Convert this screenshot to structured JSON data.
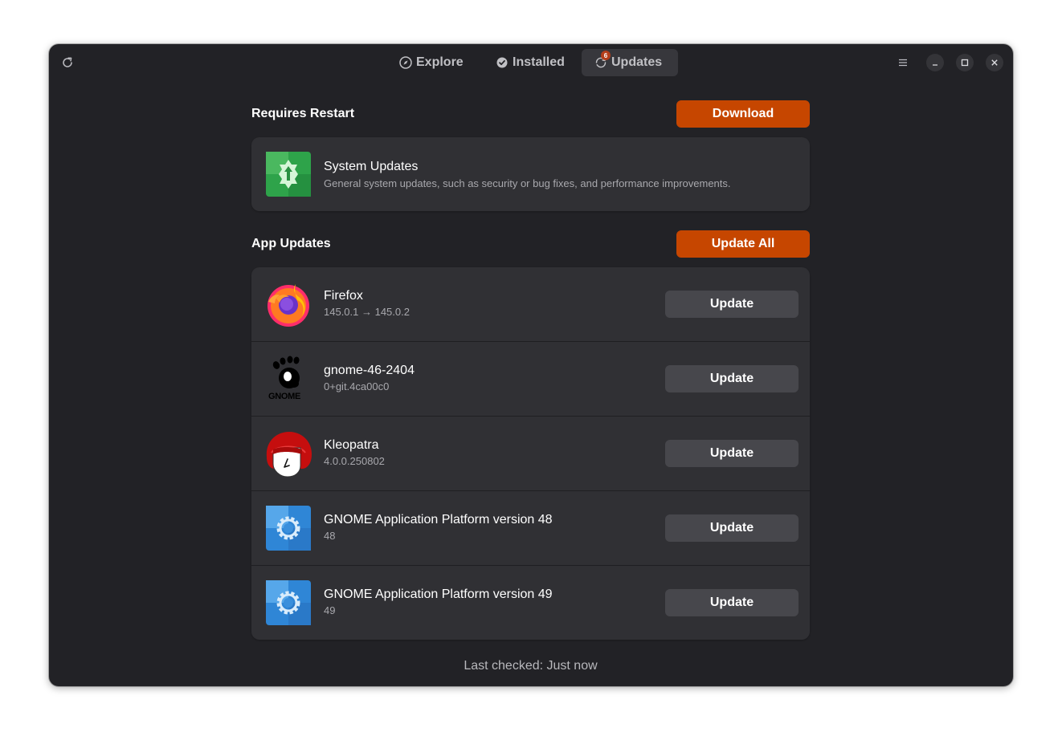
{
  "tabs": [
    {
      "label": "Explore",
      "icon": "compass-icon",
      "active": false
    },
    {
      "label": "Installed",
      "icon": "check-circle-icon",
      "active": false
    },
    {
      "label": "Updates",
      "icon": "sync-icon",
      "active": true,
      "badge": "6"
    }
  ],
  "restart_section": {
    "title": "Requires Restart",
    "button_label": "Download",
    "item": {
      "name": "System Updates",
      "description": "General system updates, such as security or bug fixes, and performance improvements.",
      "icon": "system-updates-icon"
    }
  },
  "app_section": {
    "title": "App Updates",
    "button_label": "Update All",
    "items": [
      {
        "name": "Firefox",
        "version": "145.0.1 → 145.0.2",
        "button_label": "Update",
        "icon": "firefox-icon"
      },
      {
        "name": "gnome-46-2404",
        "version": "0+git.4ca00c0",
        "button_label": "Update",
        "icon": "gnome-foot-icon",
        "logo_text": "GNOME"
      },
      {
        "name": "Kleopatra",
        "version": "4.0.0.250802",
        "button_label": "Update",
        "icon": "kleopatra-icon"
      },
      {
        "name": "GNOME Application Platform version 48",
        "version": "48",
        "button_label": "Update",
        "icon": "gnome-platform-icon"
      },
      {
        "name": "GNOME Application Platform version 49",
        "version": "49",
        "button_label": "Update",
        "icon": "gnome-platform-icon"
      }
    ]
  },
  "footer": {
    "text": "Last checked: Just now"
  },
  "colors": {
    "accent": "#c64600",
    "window_bg": "#222226",
    "card_bg": "#303034",
    "button_bg": "#47474c",
    "badge": "#b43e1a"
  }
}
